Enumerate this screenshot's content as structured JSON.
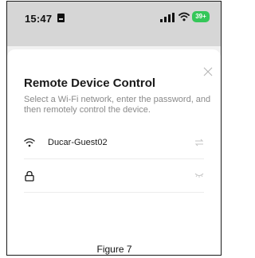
{
  "status_bar": {
    "time": "15:47",
    "battery": "39+"
  },
  "dialog": {
    "title": "Remote Device Control",
    "description": "Select a Wi-Fi network, enter the password, and then remotely control the device.",
    "network_name": "Ducar-Guest02",
    "password_value": "",
    "password_placeholder": ""
  },
  "caption": "Figure 7",
  "icons": {
    "status_doc": "doc-icon",
    "signal": "signal-icon",
    "wifi_status": "wifi-icon",
    "battery": "battery-icon",
    "close": "close-icon",
    "wifi_row": "wifi-icon",
    "switch_network": "switch-arrows-icon",
    "lock": "lock-icon",
    "eye": "eye-closed-icon"
  },
  "colors": {
    "battery": "#35c759",
    "status_bar_bg": "#d6d6d6",
    "title": "#1a1a1a",
    "description": "#8a8a8a"
  }
}
